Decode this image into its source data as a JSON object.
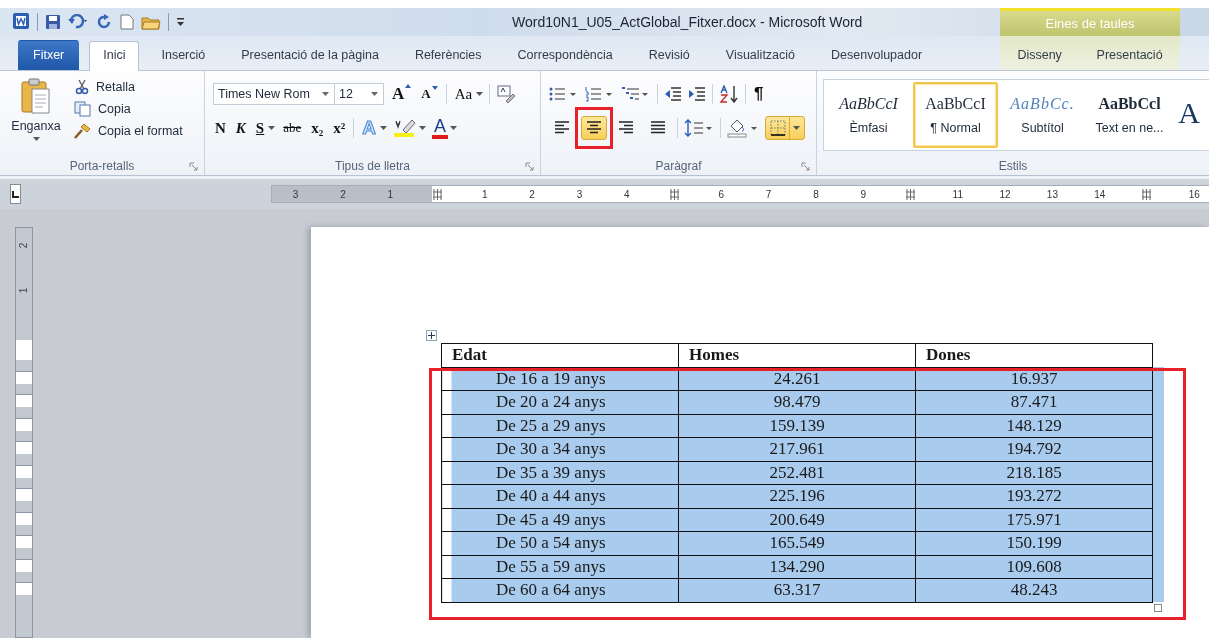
{
  "window": {
    "title": "Word10N1_U05_ActGlobal_Fitxer.docx - Microsoft Word"
  },
  "contextual_group": {
    "label": "Eines de taules"
  },
  "tabs": [
    {
      "label": "Fitxer",
      "kind": "file",
      "selected": false
    },
    {
      "label": "Inici",
      "kind": "main",
      "selected": true
    },
    {
      "label": "Inserció",
      "kind": "main",
      "selected": false
    },
    {
      "label": "Presentació de la pàgina",
      "kind": "main",
      "selected": false
    },
    {
      "label": "Referències",
      "kind": "main",
      "selected": false
    },
    {
      "label": "Correspondència",
      "kind": "main",
      "selected": false
    },
    {
      "label": "Revisió",
      "kind": "main",
      "selected": false
    },
    {
      "label": "Visualització",
      "kind": "main",
      "selected": false
    },
    {
      "label": "Desenvolupador",
      "kind": "main",
      "selected": false
    },
    {
      "label": "Disseny",
      "kind": "context",
      "selected": false
    },
    {
      "label": "Presentació",
      "kind": "context",
      "selected": false
    }
  ],
  "clipboard": {
    "title": "Porta-retalls",
    "paste": "Enganxa",
    "cut": "Retalla",
    "copy": "Copia",
    "format_painter": "Copia el format"
  },
  "font": {
    "title": "Tipus de lletra",
    "font_name": "Times New Rom",
    "font_size": "12",
    "grow": "A",
    "shrink": "A",
    "change_case": "Aa",
    "bold": "N",
    "italic": "K",
    "underline": "S",
    "strikethrough": "abe",
    "subscript": "x₂",
    "superscript": "x²",
    "text_effects": "A",
    "font_color": "A"
  },
  "paragraph": {
    "title": "Paràgraf",
    "show_marks": "¶",
    "borders_active": true,
    "alignments": [
      {
        "kind": "left",
        "selected": false,
        "highlighted": false
      },
      {
        "kind": "center",
        "selected": true,
        "highlighted": true
      },
      {
        "kind": "right",
        "selected": false,
        "highlighted": false
      },
      {
        "kind": "justify",
        "selected": false,
        "highlighted": false
      }
    ]
  },
  "styles": {
    "title": "Estils",
    "items": [
      {
        "sample": "AaBbCcI",
        "label": "Èmfasi",
        "kind": "emphasis",
        "selected": false
      },
      {
        "sample": "AaBbCcI",
        "label": "¶ Normal",
        "kind": "normal",
        "selected": true
      },
      {
        "sample": "AaBbCc.",
        "label": "Subtítol",
        "kind": "subtitle",
        "selected": false
      },
      {
        "sample": "AaBbCcl",
        "label": "Text en ne...",
        "kind": "strong",
        "selected": false
      },
      {
        "sample": "A",
        "kind": "title",
        "selected": false
      }
    ]
  },
  "ruler": [
    {
      "kind": "number",
      "label": "3"
    },
    {
      "kind": "number",
      "label": "2"
    },
    {
      "kind": "number",
      "label": "1"
    },
    {
      "kind": "marker"
    },
    {
      "kind": "number",
      "label": "1"
    },
    {
      "kind": "number",
      "label": "2"
    },
    {
      "kind": "number",
      "label": "3"
    },
    {
      "kind": "number",
      "label": "4"
    },
    {
      "kind": "marker"
    },
    {
      "kind": "number",
      "label": "6"
    },
    {
      "kind": "number",
      "label": "7"
    },
    {
      "kind": "number",
      "label": "8"
    },
    {
      "kind": "number",
      "label": "9"
    },
    {
      "kind": "marker"
    },
    {
      "kind": "number",
      "label": "11"
    },
    {
      "kind": "number",
      "label": "12"
    },
    {
      "kind": "number",
      "label": "13"
    },
    {
      "kind": "number",
      "label": "14"
    },
    {
      "kind": "marker"
    },
    {
      "kind": "number",
      "label": "16"
    }
  ],
  "vertical_ruler": [
    "2",
    "1"
  ],
  "table": {
    "highlighted": true,
    "columns": [
      "Edat",
      "Homes",
      "Dones"
    ],
    "rows": [
      {
        "selected": true,
        "cells": [
          "De 16 a 19 anys",
          "24.261",
          "16.937"
        ]
      },
      {
        "selected": true,
        "cells": [
          "De 20 a 24 anys",
          "98.479",
          "87.471"
        ]
      },
      {
        "selected": true,
        "cells": [
          "De 25 a 29 anys",
          "159.139",
          "148.129"
        ]
      },
      {
        "selected": true,
        "cells": [
          "De 30 a 34 anys",
          "217.961",
          "194.792"
        ]
      },
      {
        "selected": true,
        "cells": [
          "De 35 a 39 anys",
          "252.481",
          "218.185"
        ]
      },
      {
        "selected": true,
        "cells": [
          "De 40 a 44 anys",
          "225.196",
          "193.272"
        ]
      },
      {
        "selected": true,
        "cells": [
          "De 45 a 49 anys",
          "200.649",
          "175.971"
        ]
      },
      {
        "selected": true,
        "cells": [
          "De 50 a 54 anys",
          "165.549",
          "150.199"
        ]
      },
      {
        "selected": true,
        "cells": [
          "De 55 a 59 anys",
          "134.290",
          "109.608"
        ]
      },
      {
        "selected": true,
        "cells": [
          "De 60 a 64 anys",
          "63.317",
          "48.243"
        ]
      }
    ]
  }
}
